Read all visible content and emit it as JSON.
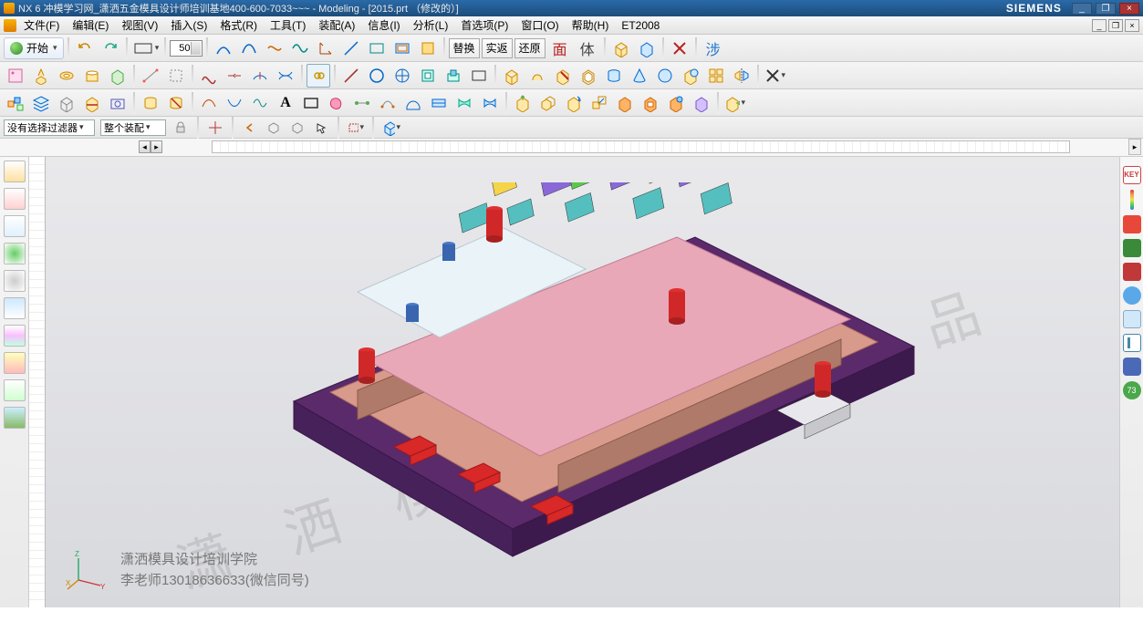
{
  "titlebar": {
    "text": "NX 6 冲模学习网_潇洒五金模具设计师培训基地400-600-7033~~~ - Modeling - [2015.prt （修改的）]",
    "brand": "SIEMENS"
  },
  "menus": {
    "file": "文件(F)",
    "edit": "编辑(E)",
    "view": "视图(V)",
    "insert": "插入(S)",
    "format": "格式(R)",
    "tools": "工具(T)",
    "assembly": "装配(A)",
    "info": "信息(I)",
    "analysis": "分析(L)",
    "pref": "首选项(P)",
    "window": "窗口(O)",
    "help": "帮助(H)",
    "et": "ET2008"
  },
  "toolbar1": {
    "start": "开始",
    "spin_value": "50",
    "replace": "替换",
    "actual": "实返",
    "restore": "还原",
    "face": "面",
    "body": "体",
    "interf": "涉"
  },
  "toolbar3": {
    "A": "A"
  },
  "filter": {
    "sel_filter": "没有选择过滤器",
    "scope": "整个装配"
  },
  "credit": {
    "line1": "潇洒模具设计培训学院",
    "line2": "李老师13018636633(微信同号)"
  },
  "watermark": "潇 洒 模 具 学 员 作 品",
  "rightpal": {
    "key": "KEY",
    "pct": "73"
  }
}
